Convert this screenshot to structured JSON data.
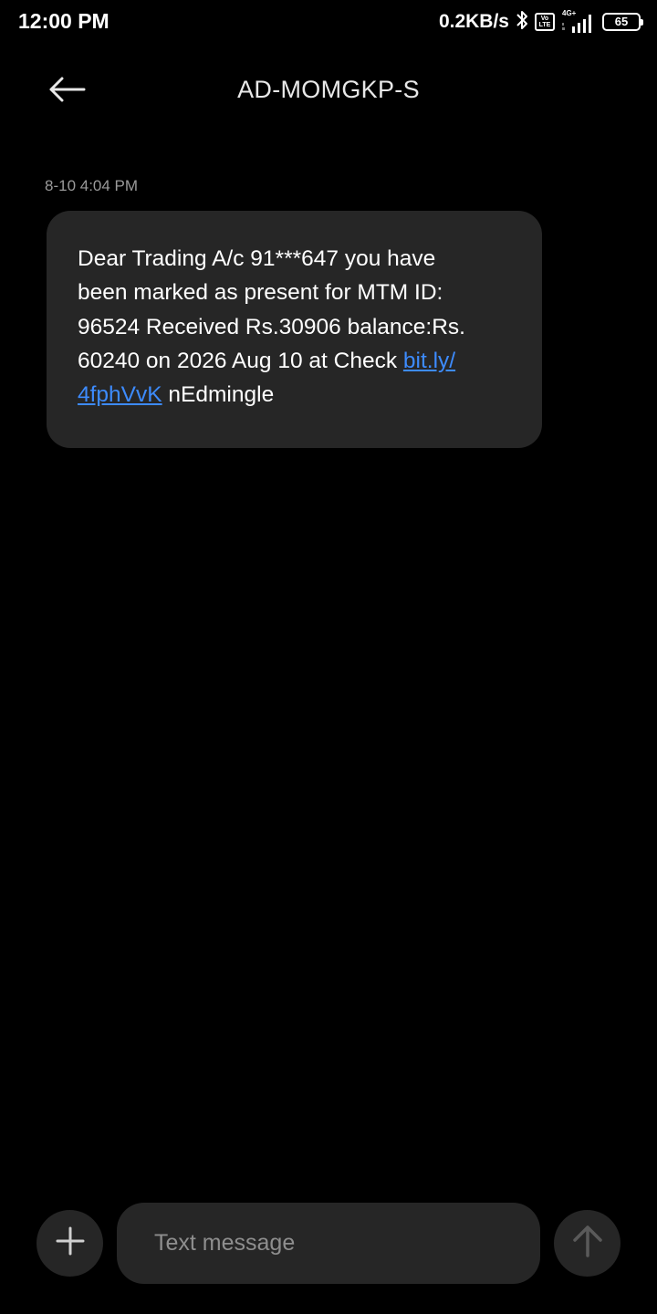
{
  "status_bar": {
    "time": "12:00 PM",
    "net_speed": "0.2KB/s",
    "volte_label": "Vo LTE",
    "network_type": "4G+",
    "battery_level": "65",
    "icons": [
      "bluetooth-icon",
      "volte-icon",
      "signal-icon",
      "battery-icon"
    ]
  },
  "header": {
    "back_icon": "back-arrow-icon",
    "title": "AD-MOMGKP-S"
  },
  "conversation": {
    "timestamp": "8-10 4:04 PM",
    "message": {
      "text_before_link": "Dear Trading A/c 91***647 you have\nbeen marked as present for MTM ID:\n96524 Received Rs.30906 balance:Rs.\n60240 on 2026 Aug 10 at Check ",
      "link_text": "bit.ly/\n4fphVvK",
      "text_after_link": " nEdmingle"
    }
  },
  "composer": {
    "add_icon": "plus-icon",
    "placeholder": "Text message",
    "send_icon": "send-arrow-icon"
  },
  "colors": {
    "background": "#000000",
    "bubble": "#262626",
    "link": "#3d8bfd",
    "timestamp": "#9a9a9a"
  }
}
